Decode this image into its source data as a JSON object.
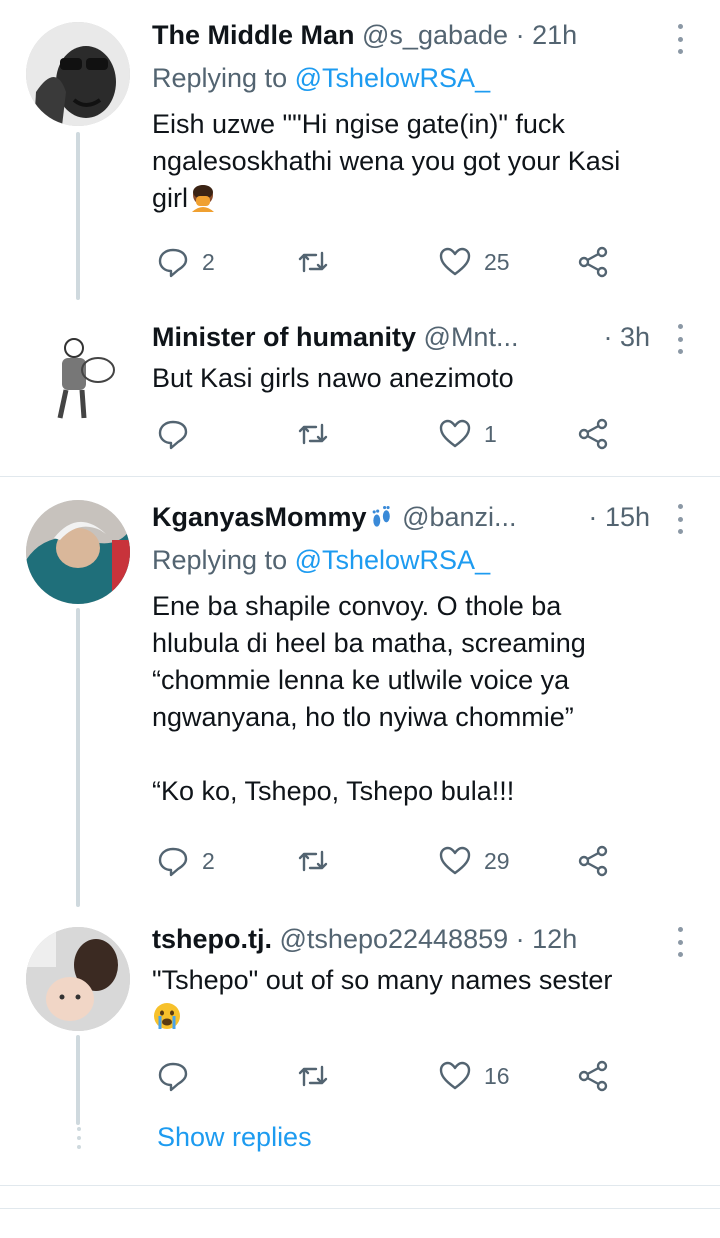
{
  "colors": {
    "accent": "#1d9bf0",
    "muted": "#536471",
    "text": "#0f1419",
    "line": "#cfd9de"
  },
  "tweets": [
    {
      "display_name": "The Middle Man",
      "handle": "@s_gabade",
      "dot": "·",
      "time": "21h",
      "replying_prefix": "Replying to ",
      "replying_to": "@TshelowRSA_",
      "text": "Eish uzwe \"\"Hi ngise gate(in)\" fuck\nngalesoskhathi wena you got your Kasi\ngirl",
      "emoji": "face-palm-emoji",
      "replies": "2",
      "retweets": "",
      "likes": "25"
    },
    {
      "display_name": "Minister of humanity",
      "handle": "@Mnt...",
      "dot": "·",
      "time": "3h",
      "text": "But Kasi girls nawo anezimoto",
      "replies": "",
      "retweets": "",
      "likes": "1"
    },
    {
      "display_name": "KganyasMommy",
      "handle": "@banzi...",
      "dot": "·",
      "time": "15h",
      "replying_prefix": "Replying to ",
      "replying_to": "@TshelowRSA_",
      "text": "Ene ba shapile convoy. O thole ba\nhlubula di heel ba matha, screaming\n“chommie lenna ke utlwile voice ya\nngwanyana, ho tlo nyiwa chommie”\n\n“Ko ko, Tshepo, Tshepo bula!!!",
      "emoji": "footprints-emoji",
      "replies": "2",
      "retweets": "",
      "likes": "29"
    },
    {
      "display_name": "tshepo.tj.",
      "handle": "@tshepo22448859",
      "dot": "·",
      "time": "12h",
      "text": "\"Tshepo\" out of so many names sester",
      "emoji": "crying-face-emoji",
      "replies": "",
      "retweets": "",
      "likes": "16"
    }
  ],
  "show_replies": "Show replies"
}
